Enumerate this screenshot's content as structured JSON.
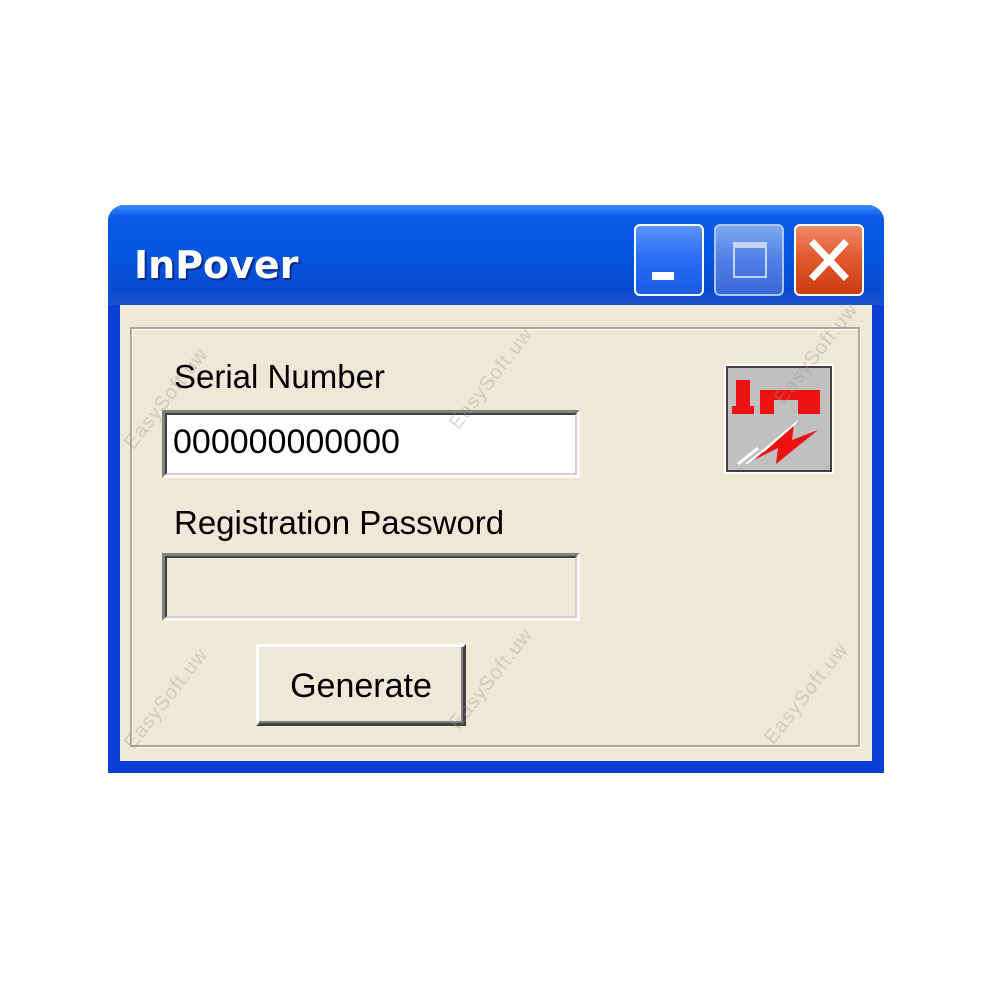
{
  "window": {
    "title": "InPover",
    "buttons": {
      "minimize": "minimize",
      "maximize": "maximize",
      "close": "close"
    }
  },
  "form": {
    "serial_label": "Serial Number",
    "serial_value": "000000000000",
    "password_label": "Registration Password",
    "password_value": "",
    "generate_label": "Generate"
  },
  "logo": {
    "text": "In",
    "icon": "lightning-bolt-icon"
  },
  "watermark": {
    "text": "EasySoft.uw"
  },
  "colors": {
    "titlebar": "#0556e0",
    "client_bg": "#ece9d8",
    "close_button": "#e25a2f",
    "logo_red": "#ee1111"
  }
}
